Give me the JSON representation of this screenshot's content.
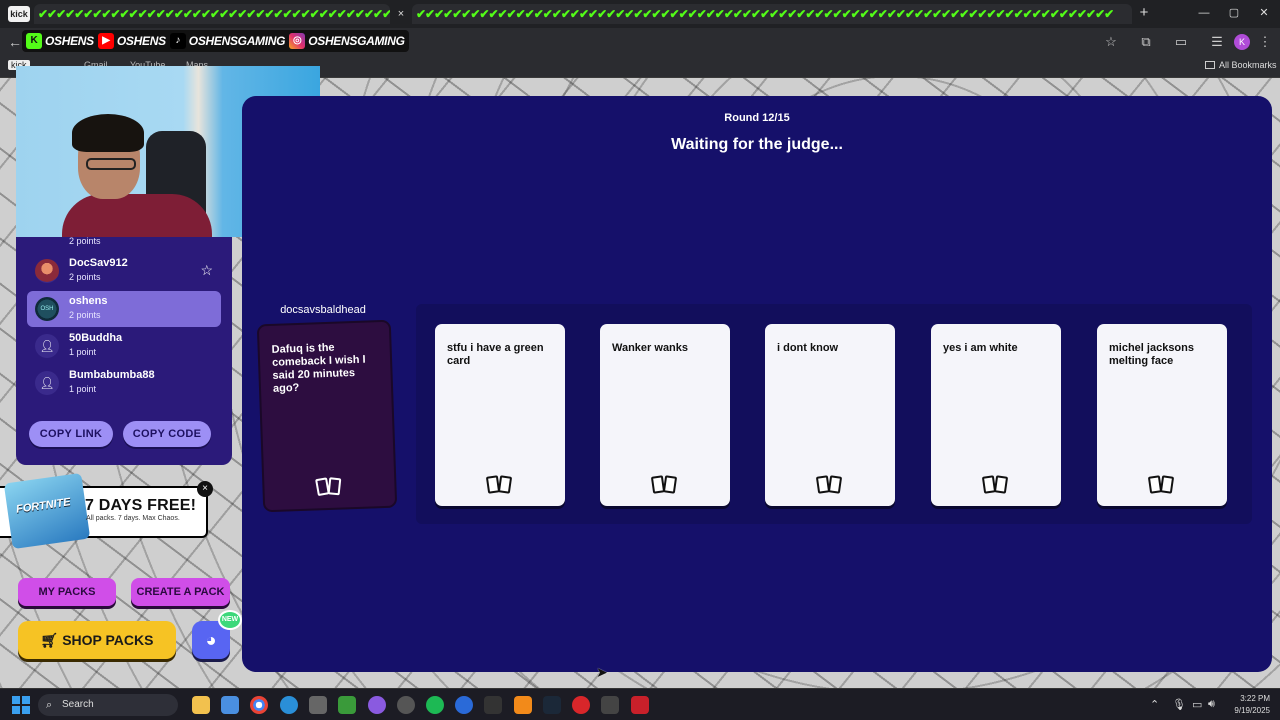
{
  "browser": {
    "tab_favicon": "kick",
    "tab1_text": "✔✔✔✔✔✔✔✔✔✔✔✔✔✔✔✔✔✔✔✔✔✔✔✔✔✔✔✔✔✔✔✔✔✔✔✔✔✔✔✔✔✔✔✔✔✔✔✔",
    "tab2_text": "✔✔✔✔✔✔✔✔✔✔✔✔✔✔✔✔✔✔✔✔✔✔✔✔✔✔✔✔✔✔✔✔✔✔✔✔✔✔✔✔✔✔✔✔✔✔✔✔✔✔✔✔✔✔✔✔✔✔✔✔✔✔✔✔✔✔✔✔✔✔✔✔✔✔✔✔✔",
    "tab_close": "×",
    "new_tab": "+",
    "profile_initial": "K",
    "bookmark_kick": "kick",
    "bookmark_gmail": "Gmail",
    "bookmark_youtube": "YouTube",
    "bookmark_maps": "Maps",
    "all_bookmarks": "All Bookmarks",
    "accent_kick": "#53fc18"
  },
  "overlay": {
    "socials": [
      {
        "icon": "kick-icon",
        "label": "OSHENS"
      },
      {
        "icon": "youtube-icon",
        "label": "OSHENS"
      },
      {
        "icon": "tiktok-icon",
        "label": "OSHENSGAMING"
      },
      {
        "icon": "instagram-icon",
        "label": "OSHENSGAMING"
      }
    ]
  },
  "players": {
    "top_points": "2 points",
    "list": [
      {
        "name": "DocSav912",
        "points": "2 points",
        "judge": true
      },
      {
        "name": "oshens",
        "points": "2 points",
        "active": true
      },
      {
        "name": "50Buddha",
        "points": "1 point"
      },
      {
        "name": "Bumbabumba88",
        "points": "1 point"
      }
    ]
  },
  "invite": {
    "copy_link": "COPY LINK",
    "copy_code": "COPY CODE"
  },
  "promo": {
    "art_label": "FORTNITE",
    "title": "7 DAYS FREE!",
    "subtitle": "All packs. 7 days. Max Chaos.",
    "close": "×"
  },
  "actions": {
    "my_packs": "MY PACKS",
    "create_pack": "CREATE A PACK",
    "shop_packs": "SHOP PACKS",
    "discord_badge": "NEW"
  },
  "game": {
    "round": "Round 12/15",
    "status": "Waiting for the judge...",
    "judge_name": "docsavsbaldhead",
    "prompt_card": "Dafuq is the comeback I wish I said 20 minutes ago?",
    "answers": [
      "stfu i have a green card",
      "Wanker wanks",
      "i dont know",
      "yes i am white",
      "michel jacksons melting face"
    ]
  },
  "taskbar": {
    "search_placeholder": "Search",
    "time": "3:22 PM",
    "date": "9/19/2025"
  }
}
